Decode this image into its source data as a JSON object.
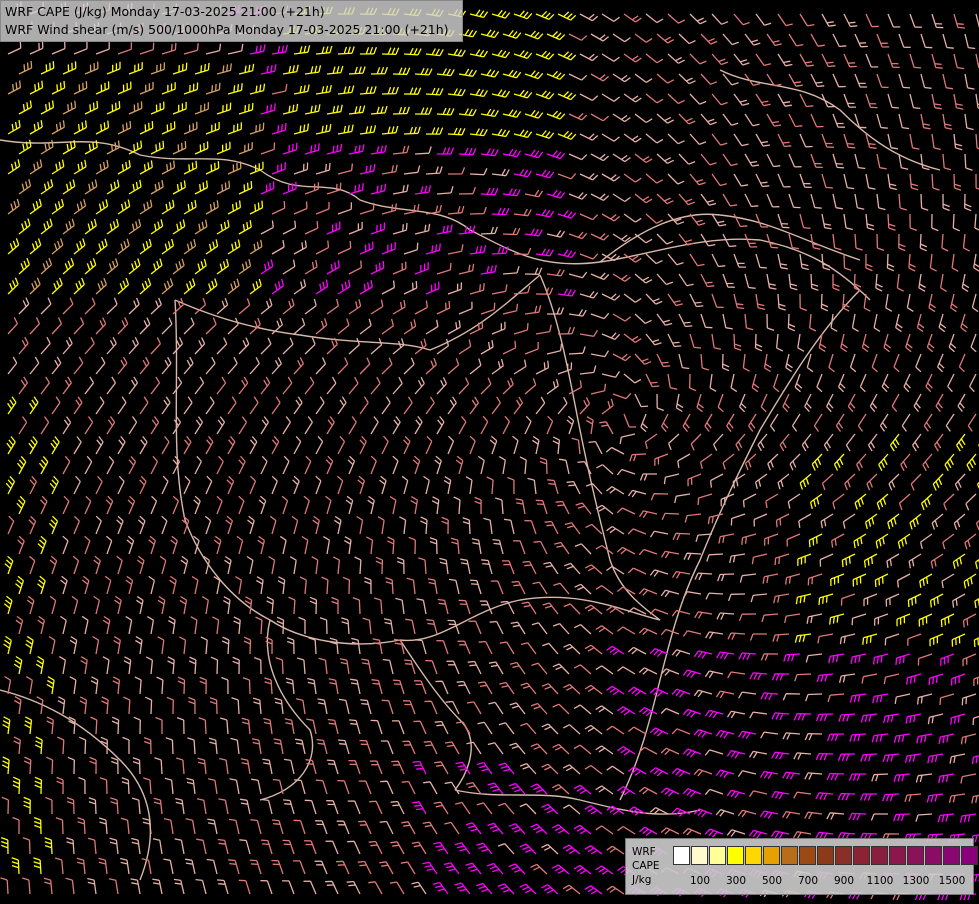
{
  "header": {
    "line1": "WRF CAPE (J/kg) Monday 17-03-2025 21:00 (+21h)",
    "line2": "WRF Wind shear (m/s) 500/1000hPa Monday 17-03-2025 21:00 (+21h)"
  },
  "legend": {
    "label_model": "WRF",
    "label_field": "CAPE",
    "label_unit": "J/kg",
    "colors": [
      "#ffffff",
      "#fffacd",
      "#ffff99",
      "#ffff00",
      "#ffd700",
      "#e6a000",
      "#b86d1a",
      "#9a4a12",
      "#8c3a1a",
      "#8a2e2a",
      "#8a2434",
      "#8a1e40",
      "#8a184c",
      "#8a1258",
      "#8a0c64",
      "#8a0670",
      "#8a007c"
    ],
    "ticks": [
      "100",
      "300",
      "500",
      "700",
      "900",
      "1100",
      "1300",
      "1500"
    ]
  },
  "map": {
    "barb_colors": {
      "weak": "#ffffff",
      "light": "#e8b0a8",
      "moderate": "#e07878",
      "strong": "#d6a060",
      "high_cape": "#ffff00",
      "extreme": "#ff00ff"
    }
  }
}
